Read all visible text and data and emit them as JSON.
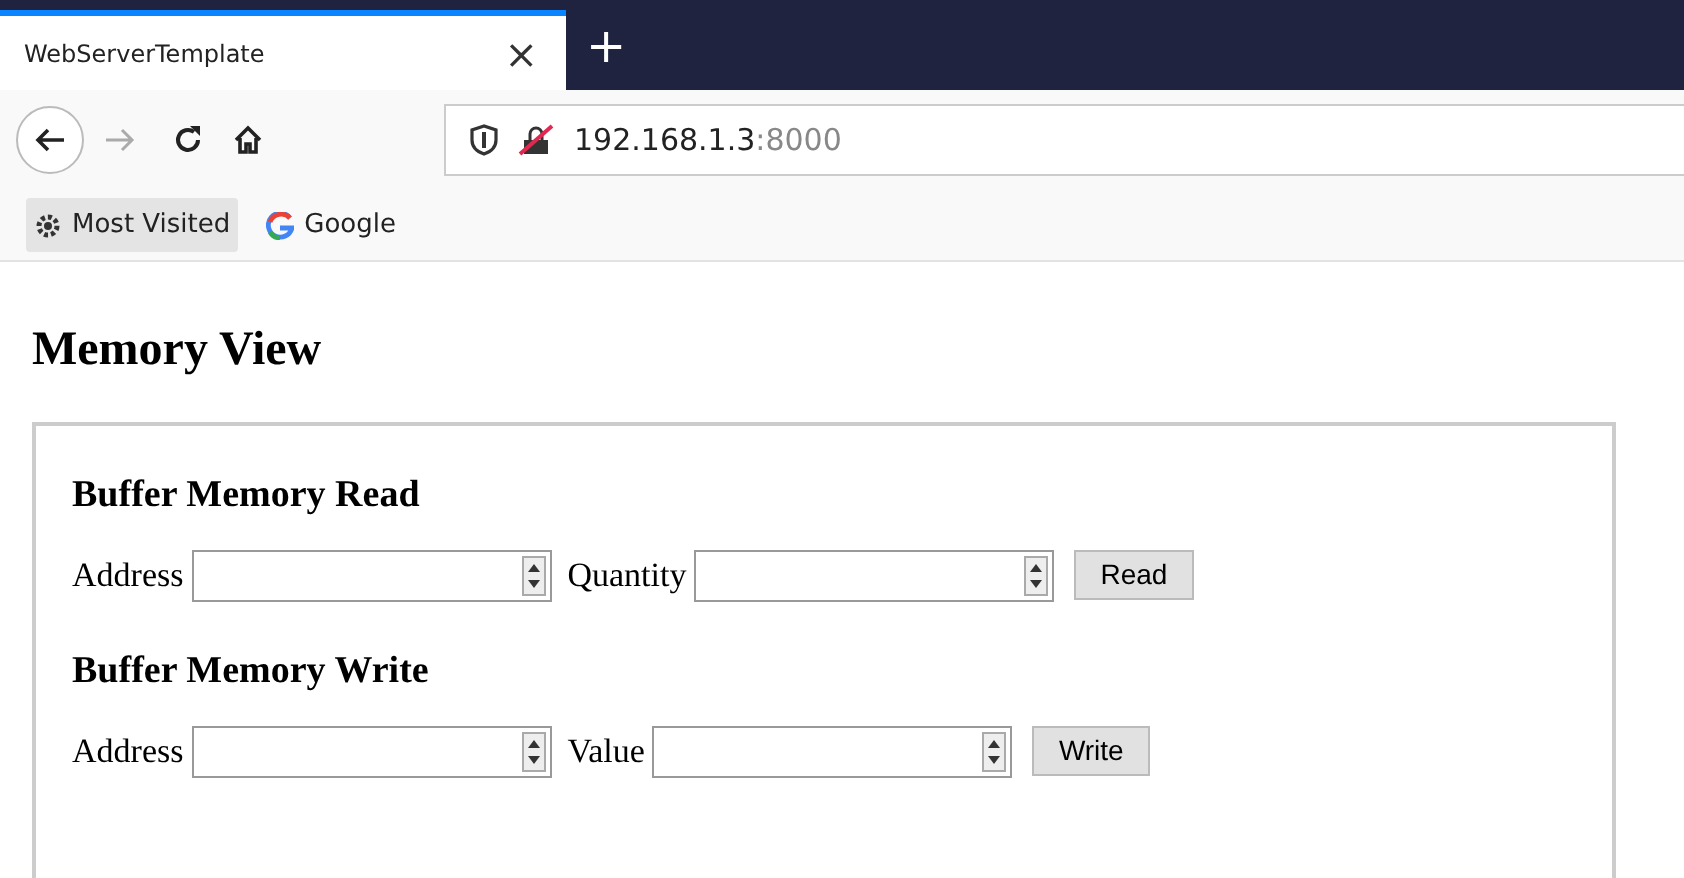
{
  "browser": {
    "tab": {
      "title": "WebServerTemplate",
      "close": "×",
      "selected": true
    },
    "new_tab": "+",
    "address": {
      "host": "192.168.1.3",
      "port": ":8000"
    },
    "bookmarks": [
      {
        "label": "Most Visited",
        "kind": "folder",
        "selected": true
      },
      {
        "label": "Google",
        "kind": "site",
        "selected": false
      }
    ]
  },
  "page": {
    "title": "Memory View",
    "sections": [
      {
        "heading": "Buffer Memory Read",
        "fields": [
          {
            "label": "Address"
          },
          {
            "label": "Quantity"
          }
        ],
        "button": "Read"
      },
      {
        "heading": "Buffer Memory Write",
        "fields": [
          {
            "label": "Address"
          },
          {
            "label": "Value"
          }
        ],
        "button": "Write"
      }
    ]
  }
}
